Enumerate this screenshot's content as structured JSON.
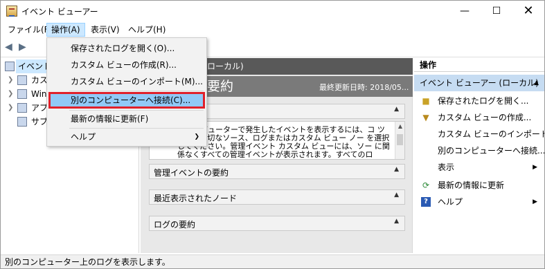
{
  "window": {
    "title": "イベント ビューアー"
  },
  "menubar": [
    {
      "label": "ファイル(F)"
    },
    {
      "label": "操作(A)"
    },
    {
      "label": "表示(V)"
    },
    {
      "label": "ヘルプ(H)"
    }
  ],
  "dropdown": [
    {
      "label": "保存されたログを開く(O)..."
    },
    {
      "label": "カスタム ビューの作成(R)..."
    },
    {
      "label": "カスタム ビューのインポート(M)..."
    },
    {
      "label": "別のコンピューターへ接続(C)..."
    },
    {
      "label": "最新の情報に更新(F)"
    },
    {
      "label": "ヘルプ"
    }
  ],
  "tree": [
    {
      "label": "イベント"
    },
    {
      "label": "カス"
    },
    {
      "label": "Win"
    },
    {
      "label": "アプ"
    },
    {
      "label": "サブ"
    }
  ],
  "center": {
    "header_suffix": "ローカル)",
    "summary_title": "要約",
    "last_updated": "最終更新日時: 2018/05...",
    "overview_text": "のコンピューターで発生したイベントを表示するには、コ ツリーで適切なソース、ログまたはカスタム ビュー ノー を選択してください。管理イベント カスタム ビューには、ソー に関係なくすべての管理イベントが表示されます。すべてのロ",
    "sections": [
      {
        "label": "管理イベントの要約"
      },
      {
        "label": "最近表示されたノード"
      },
      {
        "label": "ログの要約"
      }
    ]
  },
  "actions": {
    "header": "操作",
    "group": "イベント ビューアー (ローカル)",
    "items": [
      {
        "label": "保存されたログを開く...",
        "icon": "folder-icon"
      },
      {
        "label": "カスタム ビューの作成...",
        "icon": "filter-icon"
      },
      {
        "label": "カスタム ビューのインポート...",
        "icon": ""
      },
      {
        "label": "別のコンピューターへ接続...",
        "icon": ""
      },
      {
        "label": "表示",
        "icon": ""
      },
      {
        "label": "最新の情報に更新",
        "icon": "refresh-icon"
      },
      {
        "label": "ヘルプ",
        "icon": "help-icon"
      }
    ]
  },
  "statusbar": {
    "text": "別のコンピューター上のログを表示します。"
  }
}
